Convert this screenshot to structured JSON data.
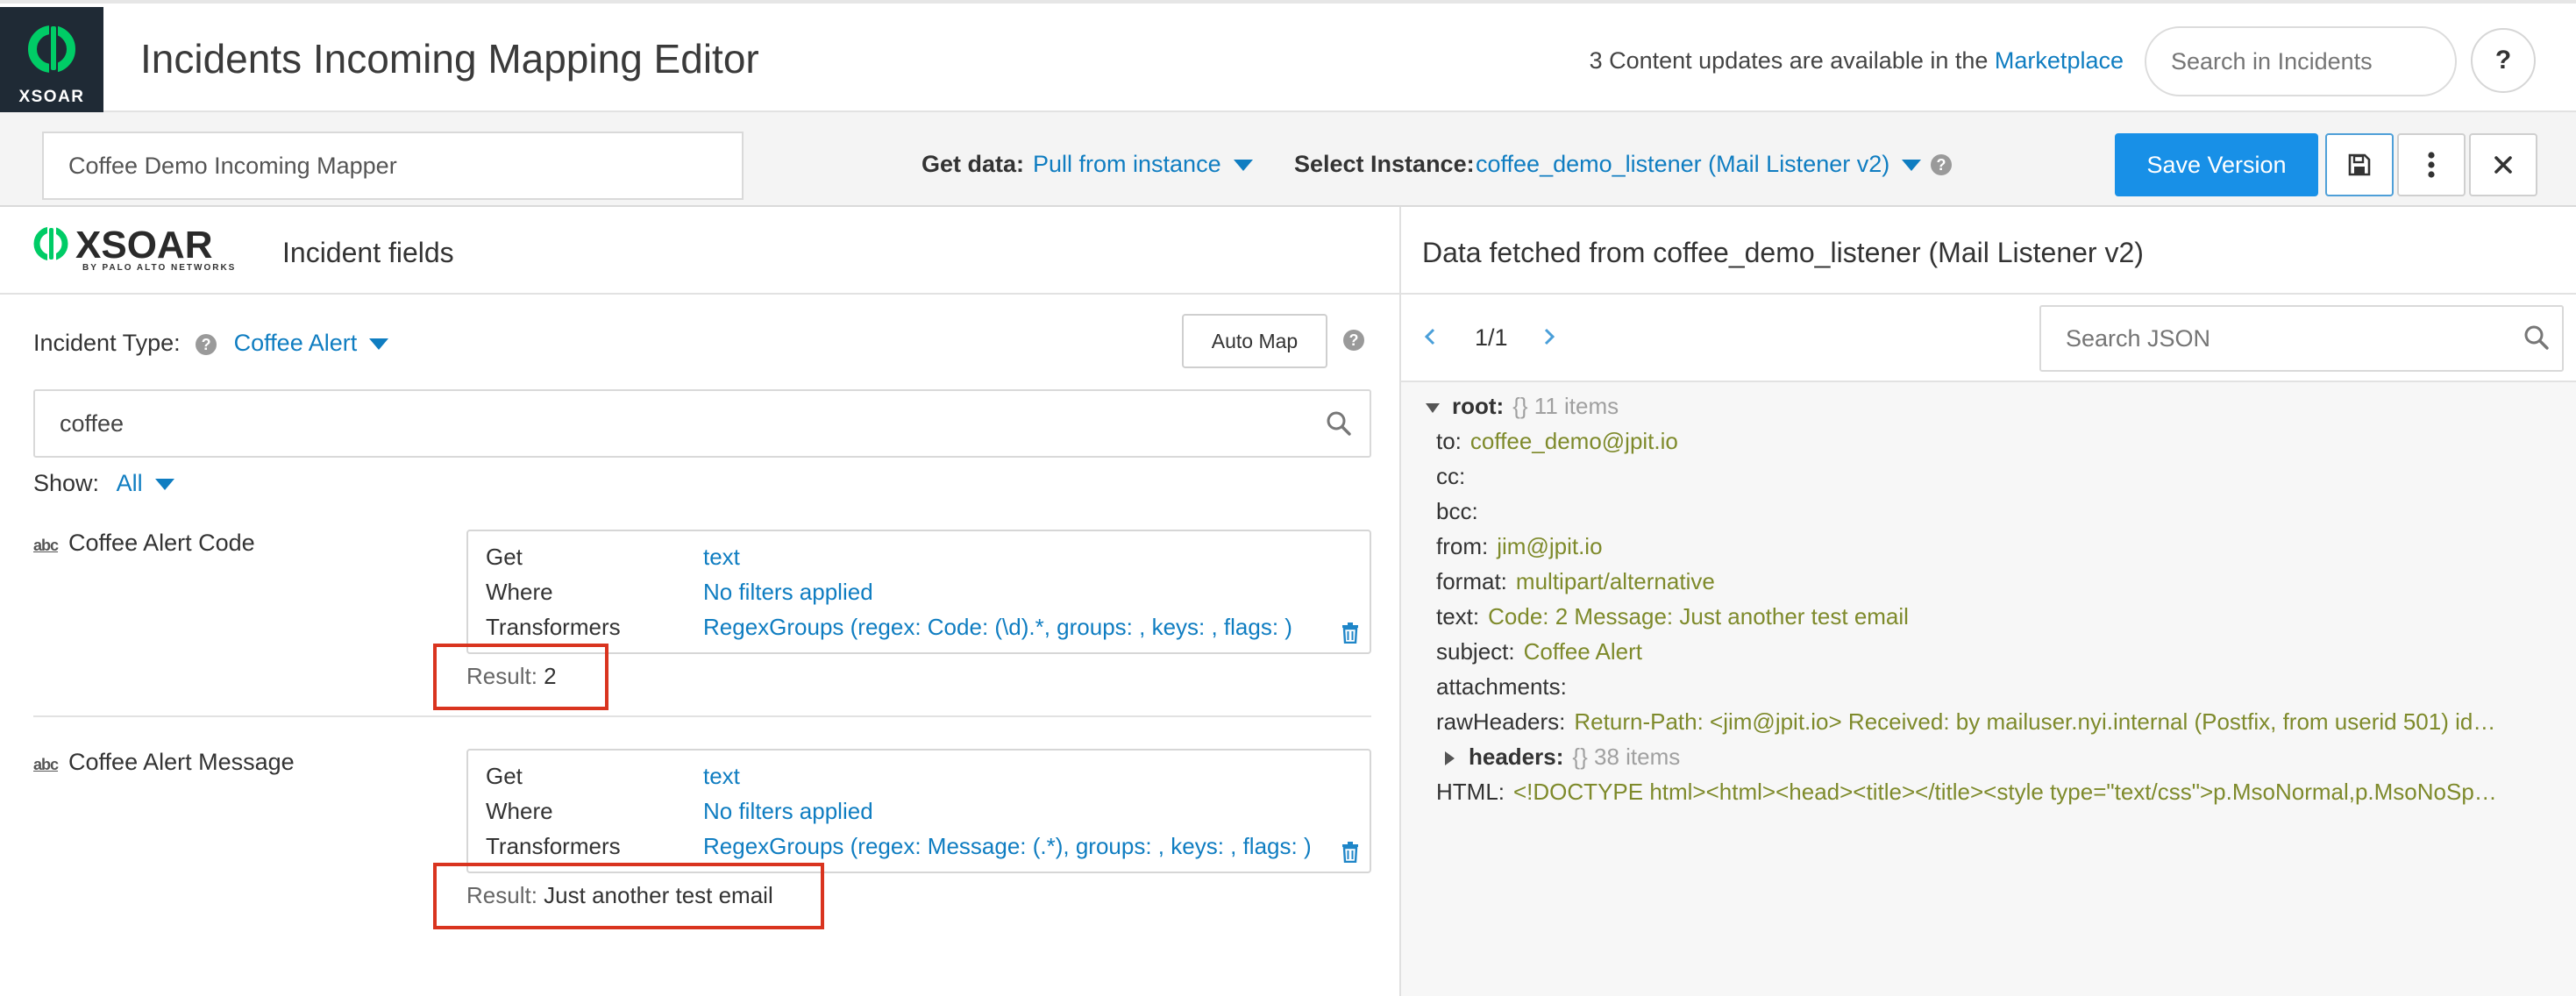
{
  "header": {
    "logo_text": "XSOAR",
    "title": "Incidents Incoming Mapping Editor",
    "updates_prefix": "3 Content updates are available in the",
    "updates_link": "Marketplace",
    "search_placeholder": "Search in Incidents",
    "help_label": "?"
  },
  "toolbar": {
    "mapper_name": "Coffee Demo Incoming Mapper",
    "get_data_label": "Get data:",
    "get_data_value": "Pull from instance",
    "select_instance_label": "Select Instance:",
    "select_instance_value": "coffee_demo_listener (Mail Listener v2)",
    "save_version_label": "Save Version"
  },
  "left_panel": {
    "brand_name": "XSOAR",
    "brand_tagline": "BY PALO ALTO NETWORKS",
    "title": "Incident fields",
    "incident_type_label": "Incident Type:",
    "incident_type_value": "Coffee Alert",
    "auto_map_label": "Auto Map",
    "field_search_value": "coffee",
    "show_label": "Show:",
    "show_value": "All",
    "fields": [
      {
        "type_icon": "abc",
        "name": "Coffee Alert Code",
        "get_label": "Get",
        "get_value": "text",
        "where_label": "Where",
        "where_value": "No filters applied",
        "transformers_label": "Transformers",
        "transformers_value": "RegexGroups (regex: Code: (\\d).*, groups: , keys: , flags: )",
        "result_label": "Result:",
        "result_value": "2"
      },
      {
        "type_icon": "abc",
        "name": "Coffee Alert Message",
        "get_label": "Get",
        "get_value": "text",
        "where_label": "Where",
        "where_value": "No filters applied",
        "transformers_label": "Transformers",
        "transformers_value": "RegexGroups (regex: Message: (.*), groups: , keys: , flags: )",
        "result_label": "Result:",
        "result_value": "Just another test email"
      }
    ]
  },
  "right_panel": {
    "title": "Data fetched from coffee_demo_listener (Mail Listener v2)",
    "pager_text": "1/1",
    "json_search_placeholder": "Search JSON",
    "root_key": "root:",
    "root_meta": "{} 11 items",
    "entries": [
      {
        "key": "to:",
        "value": "coffee_demo@jpit.io"
      },
      {
        "key": "cc:",
        "value": ""
      },
      {
        "key": "bcc:",
        "value": ""
      },
      {
        "key": "from:",
        "value": "jim@jpit.io"
      },
      {
        "key": "format:",
        "value": "multipart/alternative"
      },
      {
        "key": "text:",
        "value": "Code: 2 Message: Just another test email"
      },
      {
        "key": "subject:",
        "value": "Coffee Alert"
      },
      {
        "key": "attachments:",
        "value": ""
      },
      {
        "key": "rawHeaders:",
        "value": "Return-Path: <jim@jpit.io> Received: by mailuser.nyi.internal (Postfix, from userid 501) id…"
      },
      {
        "key": "headers:",
        "value": "{} 38 items"
      },
      {
        "key": "HTML:",
        "value": "<!DOCTYPE html><html><head><title></title><style type=\"text/css\">p.MsoNormal,p.MsoNoSp…"
      }
    ]
  },
  "colors": {
    "accent_blue": "#0f7dc1",
    "primary_button": "#1890e7",
    "json_value": "#7e8a2b",
    "highlight_red": "#d9341f",
    "logo_green": "#00cc66",
    "logo_bg": "#1f2a35"
  },
  "icons": {
    "help": "question-circle-icon",
    "caret": "caret-down-icon",
    "search": "search-icon",
    "save": "floppy-disk-icon",
    "more": "kebab-icon",
    "close": "close-icon",
    "delete": "trash-icon",
    "prev": "chevron-left-icon",
    "next": "chevron-right-icon"
  }
}
